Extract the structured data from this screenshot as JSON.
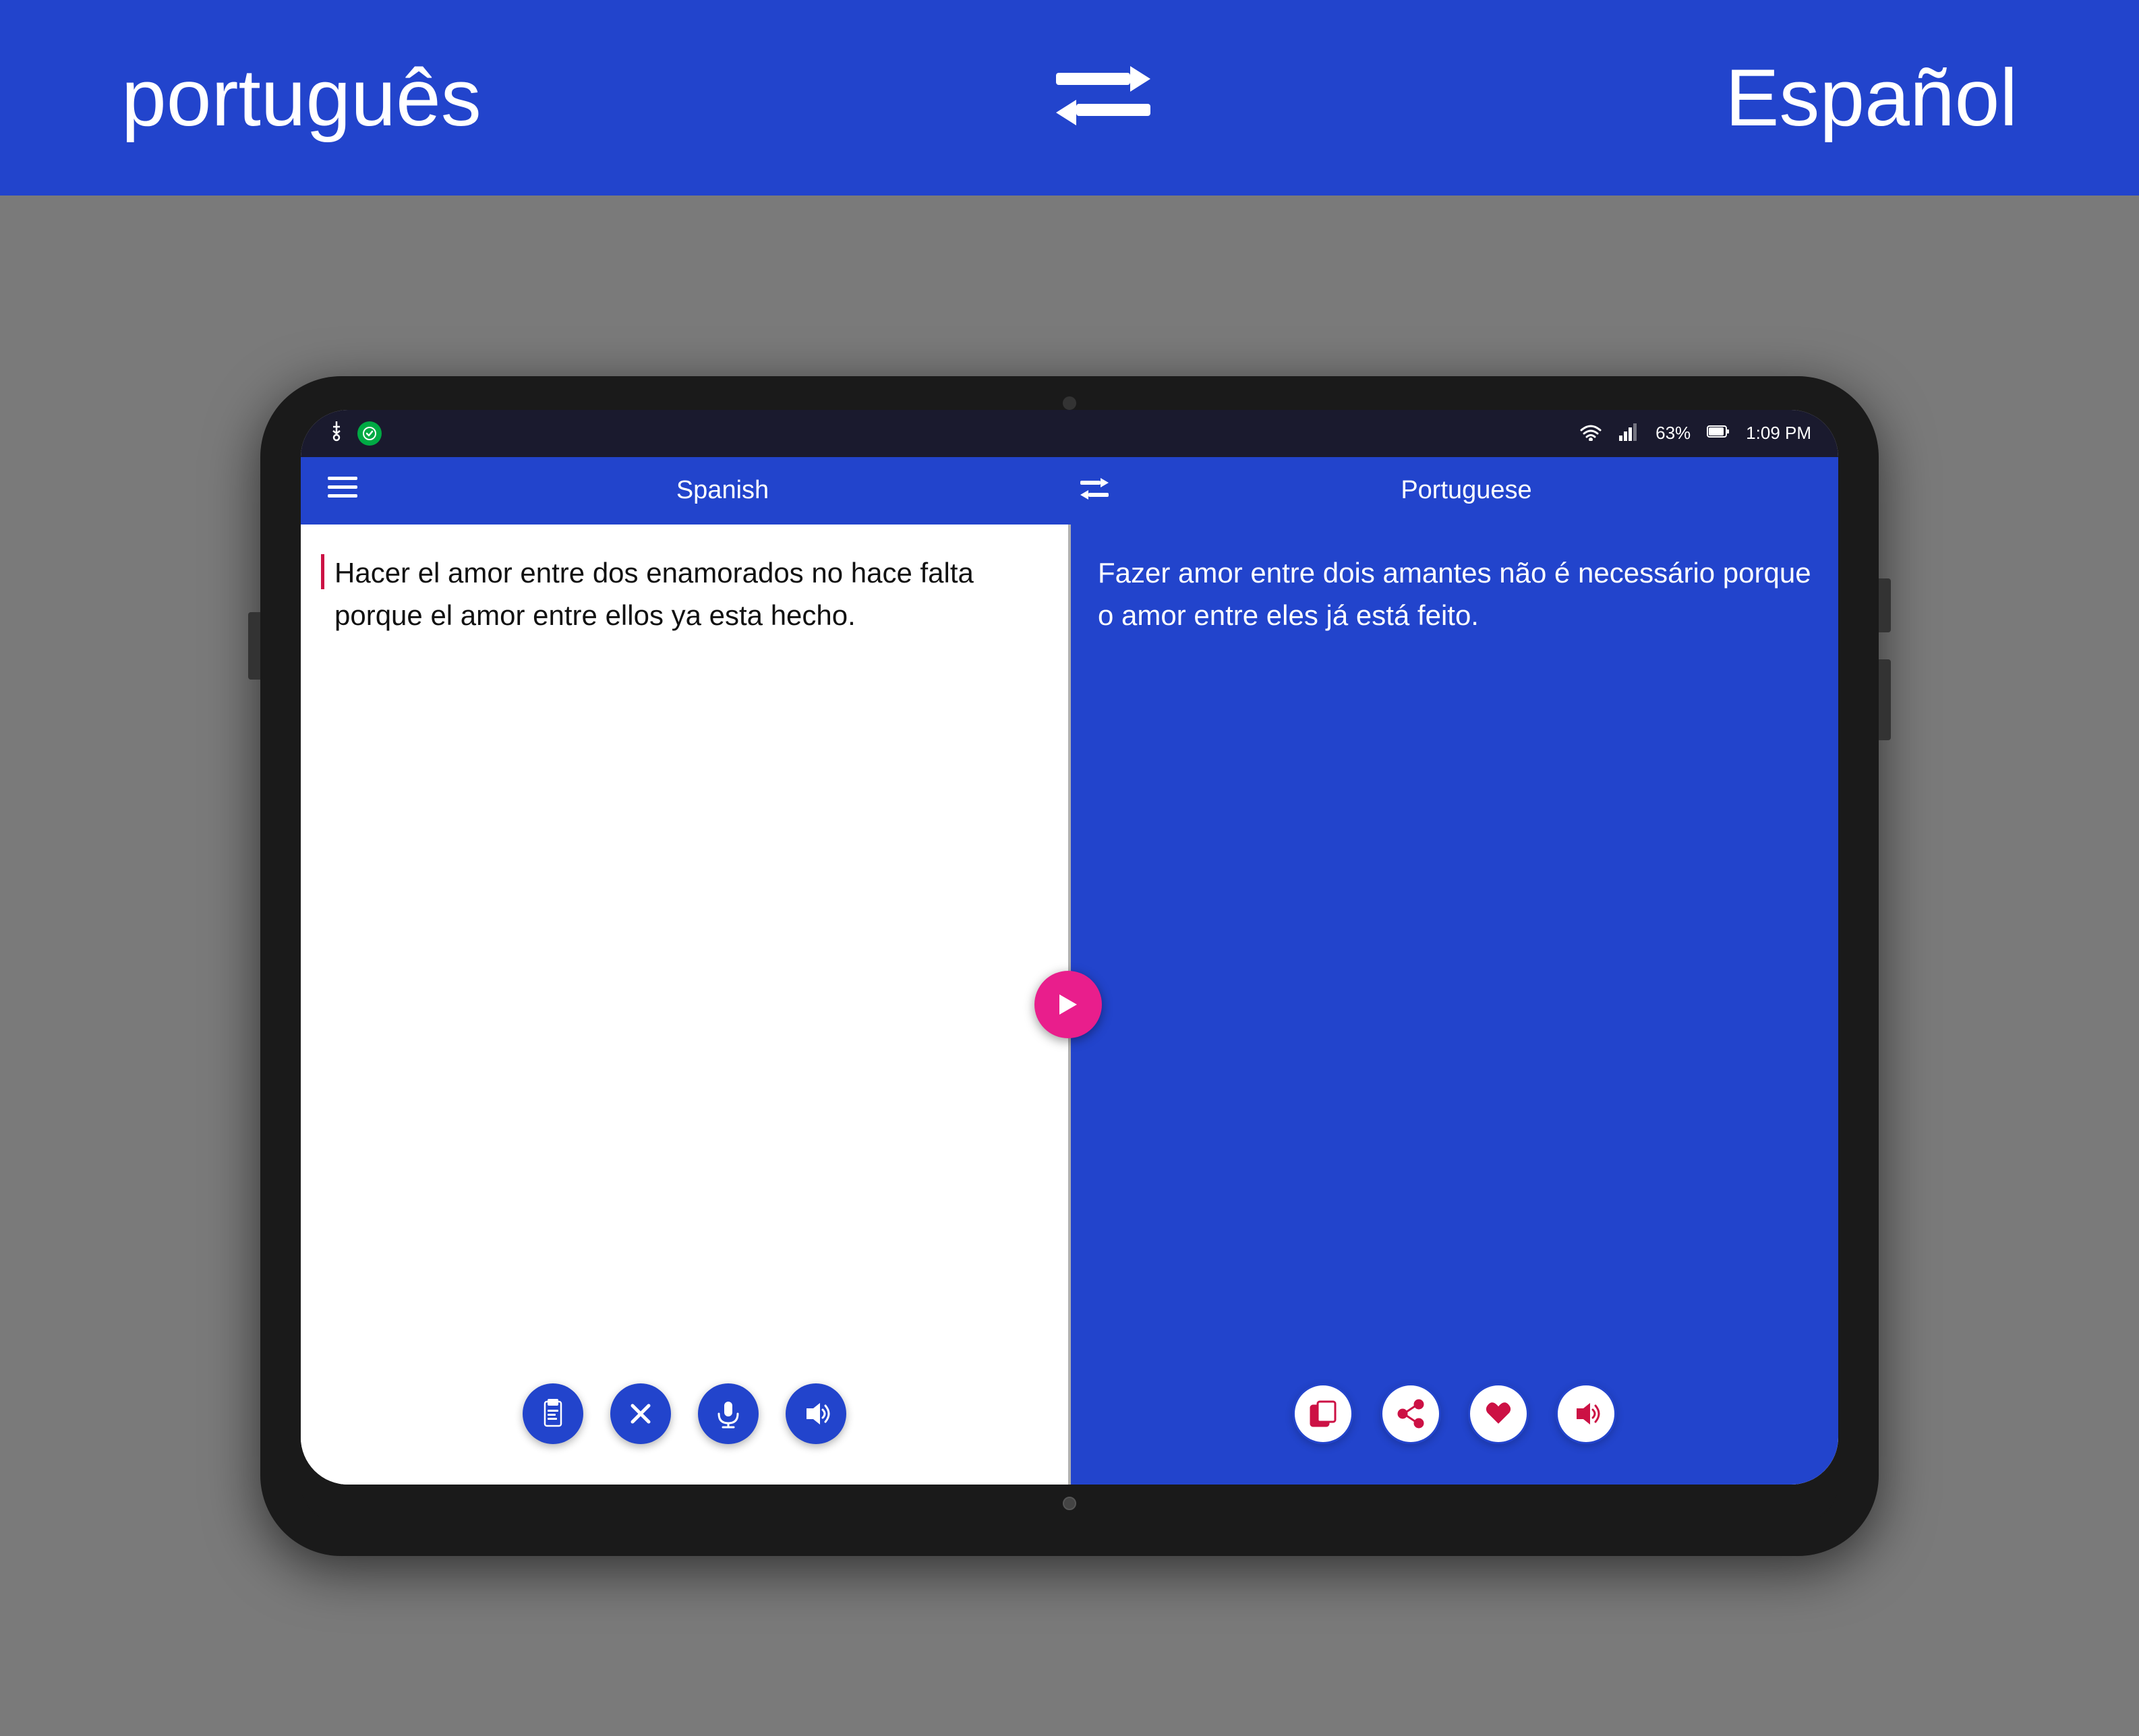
{
  "banner": {
    "lang_left": "português",
    "lang_right": "Español"
  },
  "appbar": {
    "menu_icon": "≡",
    "source_label": "Spanish",
    "target_label": "Portuguese"
  },
  "status_bar": {
    "time": "1:09 PM",
    "battery_percent": "63%",
    "wifi": "wifi",
    "signal": "signal"
  },
  "source": {
    "text": "Hacer el amor entre dos enamorados no hace falta porque el amor entre ellos ya esta hecho.",
    "actions": [
      "clipboard",
      "close",
      "microphone",
      "speaker"
    ]
  },
  "target": {
    "text": "Fazer amor entre dois amantes não é necessário porque o amor entre eles já está feito.",
    "actions": [
      "copy",
      "share",
      "heart",
      "speaker"
    ]
  }
}
